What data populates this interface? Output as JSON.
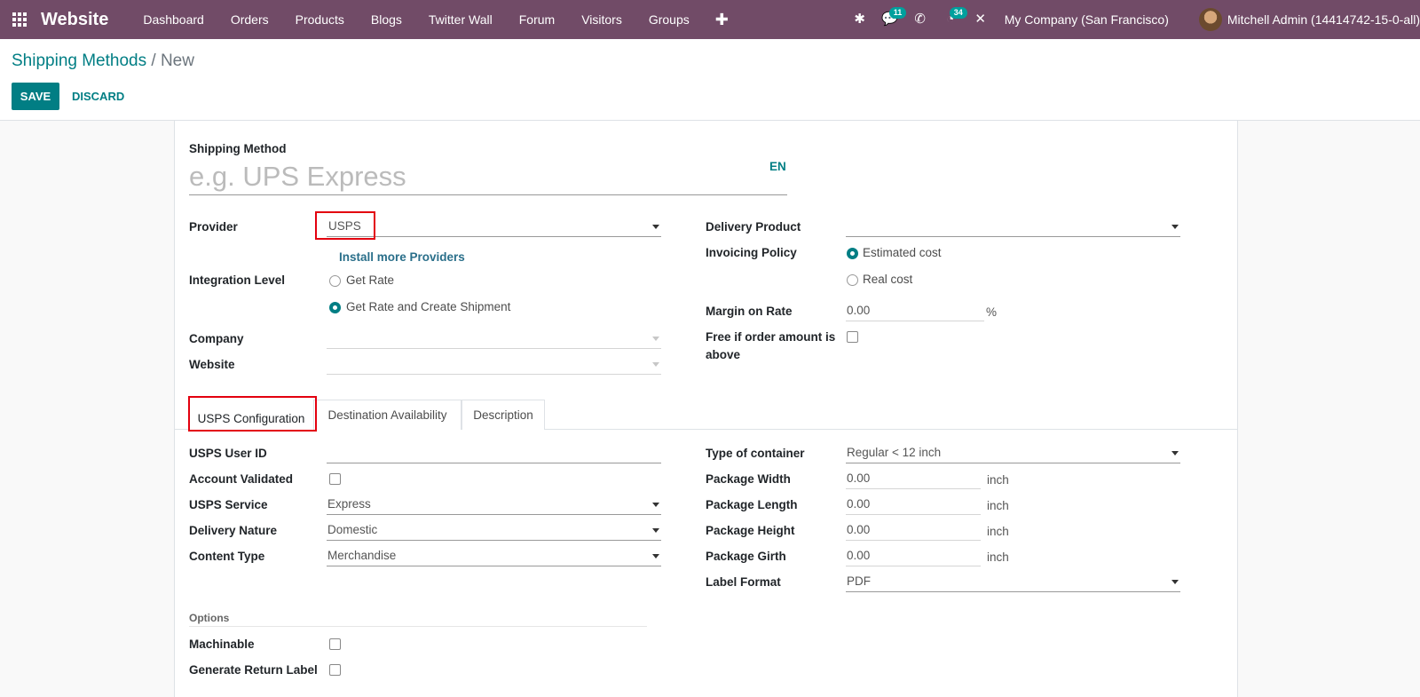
{
  "navbar": {
    "app_name": "Website",
    "menu": [
      "Dashboard",
      "Orders",
      "Products",
      "Blogs",
      "Twitter Wall",
      "Forum",
      "Visitors",
      "Groups"
    ],
    "messages_count": "11",
    "activities_count": "34",
    "company": "My Company (San Francisco)",
    "user": "Mitchell Admin (14414742-15-0-all)"
  },
  "breadcrumb": {
    "parent": "Shipping Methods",
    "separator": "/",
    "current": "New"
  },
  "buttons": {
    "save": "SAVE",
    "discard": "DISCARD"
  },
  "form": {
    "shipping_method_label": "Shipping Method",
    "shipping_method_placeholder": "e.g. UPS Express",
    "lang": "EN",
    "provider_label": "Provider",
    "provider_value": "USPS",
    "install_providers": "Install more Providers",
    "integration_label": "Integration Level",
    "integration_options": [
      "Get Rate",
      "Get Rate and Create Shipment"
    ],
    "integration_selected": "Get Rate and Create Shipment",
    "company_label": "Company",
    "website_label": "Website",
    "delivery_product_label": "Delivery Product",
    "invoicing_label": "Invoicing Policy",
    "invoicing_options": [
      "Estimated cost",
      "Real cost"
    ],
    "invoicing_selected": "Estimated cost",
    "margin_label": "Margin on Rate",
    "margin_value": "0.00",
    "margin_unit": "%",
    "free_label_1": "Free if order amount is",
    "free_label_2": "above"
  },
  "tabs": [
    "USPS Configuration",
    "Destination Availability",
    "Description"
  ],
  "active_tab": "USPS Configuration",
  "usps": {
    "user_id_label": "USPS User ID",
    "user_id_value": "",
    "account_validated_label": "Account Validated",
    "service_label": "USPS Service",
    "service_value": "Express",
    "delivery_nature_label": "Delivery Nature",
    "delivery_nature_value": "Domestic",
    "content_type_label": "Content Type",
    "content_type_value": "Merchandise",
    "container_label": "Type of container",
    "container_value": "Regular < 12 inch",
    "width_label": "Package Width",
    "width_value": "0.00",
    "length_label": "Package Length",
    "length_value": "0.00",
    "height_label": "Package Height",
    "height_value": "0.00",
    "girth_label": "Package Girth",
    "girth_value": "0.00",
    "unit": "inch",
    "label_format_label": "Label Format",
    "label_format_value": "PDF",
    "options_heading": "Options",
    "machinable_label": "Machinable",
    "return_label": "Generate Return Label"
  },
  "colors": {
    "navbar": "#714b67",
    "primary": "#017e84",
    "highlight": "#e3000f"
  }
}
